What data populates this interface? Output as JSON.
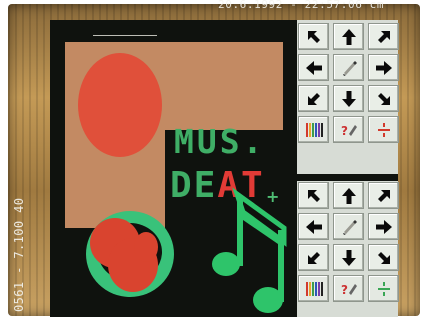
{
  "overlay": {
    "timestamp": "20.6.1992 - 22:57:06 cm",
    "side_code": "0561 - 7.100 40"
  },
  "canvas": {
    "line1": "MUS.",
    "line2_a": "DE",
    "line2_b": "AT",
    "plus": "+",
    "colors": {
      "green": "#3fae66",
      "red": "#e13b36",
      "tan": "#c38a63",
      "background": "#0f120e"
    }
  },
  "palette": {
    "top_buttons": [
      {
        "icon": "arrow-up-left-icon"
      },
      {
        "icon": "arrow-up-icon"
      },
      {
        "icon": "arrow-up-right-icon"
      },
      {
        "icon": "arrow-left-icon"
      },
      {
        "icon": "eraser-pen-icon"
      },
      {
        "icon": "arrow-right-icon"
      },
      {
        "icon": "arrow-down-left-icon"
      },
      {
        "icon": "arrow-down-icon"
      },
      {
        "icon": "arrow-down-right-icon"
      },
      {
        "icon": "color-bars-icon"
      },
      {
        "icon": "help-icon"
      },
      {
        "icon": "divide-icon"
      }
    ],
    "bottom_buttons": [
      {
        "icon": "arrow-up-left-icon"
      },
      {
        "icon": "arrow-up-icon"
      },
      {
        "icon": "arrow-up-right-icon"
      },
      {
        "icon": "arrow-left-icon"
      },
      {
        "icon": "eraser-pen-icon"
      },
      {
        "icon": "arrow-right-icon"
      },
      {
        "icon": "arrow-down-left-icon"
      },
      {
        "icon": "arrow-down-icon"
      },
      {
        "icon": "arrow-down-right-icon"
      },
      {
        "icon": "color-bars-icon"
      },
      {
        "icon": "help-icon"
      },
      {
        "icon": "divide-icon"
      }
    ]
  }
}
